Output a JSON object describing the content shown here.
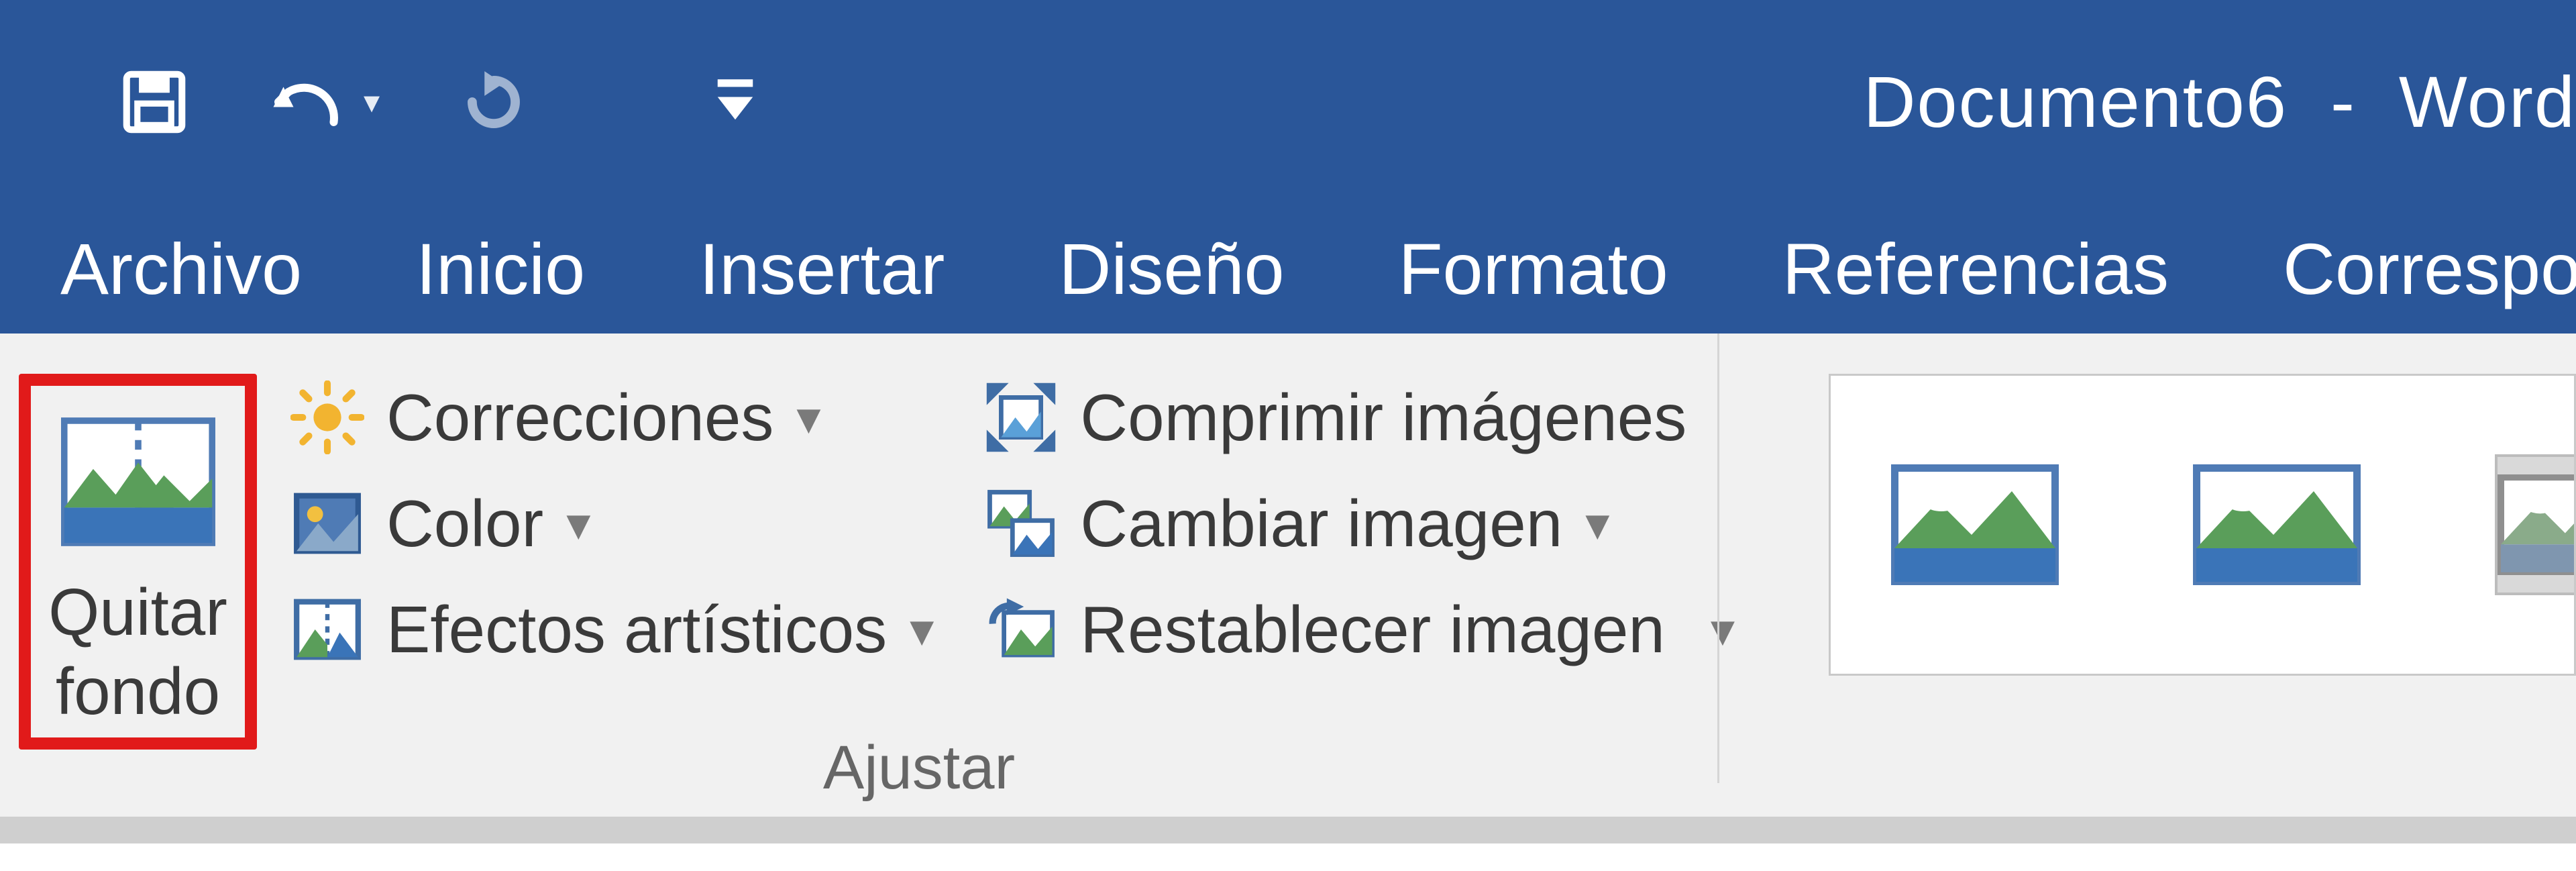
{
  "title": {
    "document": "Documento6",
    "sep": "-",
    "app": "Word"
  },
  "qat": {
    "save": "save-icon",
    "undo": "undo-icon",
    "redo": "redo-icon",
    "customize": "customize-icon"
  },
  "menu": {
    "file": "Archivo",
    "home": "Inicio",
    "insert": "Insertar",
    "design": "Diseño",
    "format": "Formato",
    "references": "Referencias",
    "mailings": "Corresponden"
  },
  "ribbon": {
    "remove_bg_line1": "Quitar",
    "remove_bg_line2": "fondo",
    "corrections": "Correcciones",
    "color": "Color",
    "artistic": "Efectos artísticos",
    "compress": "Comprimir imágenes",
    "change": "Cambiar imagen",
    "reset": "Restablecer imagen",
    "group_adjust": "Ajustar"
  }
}
